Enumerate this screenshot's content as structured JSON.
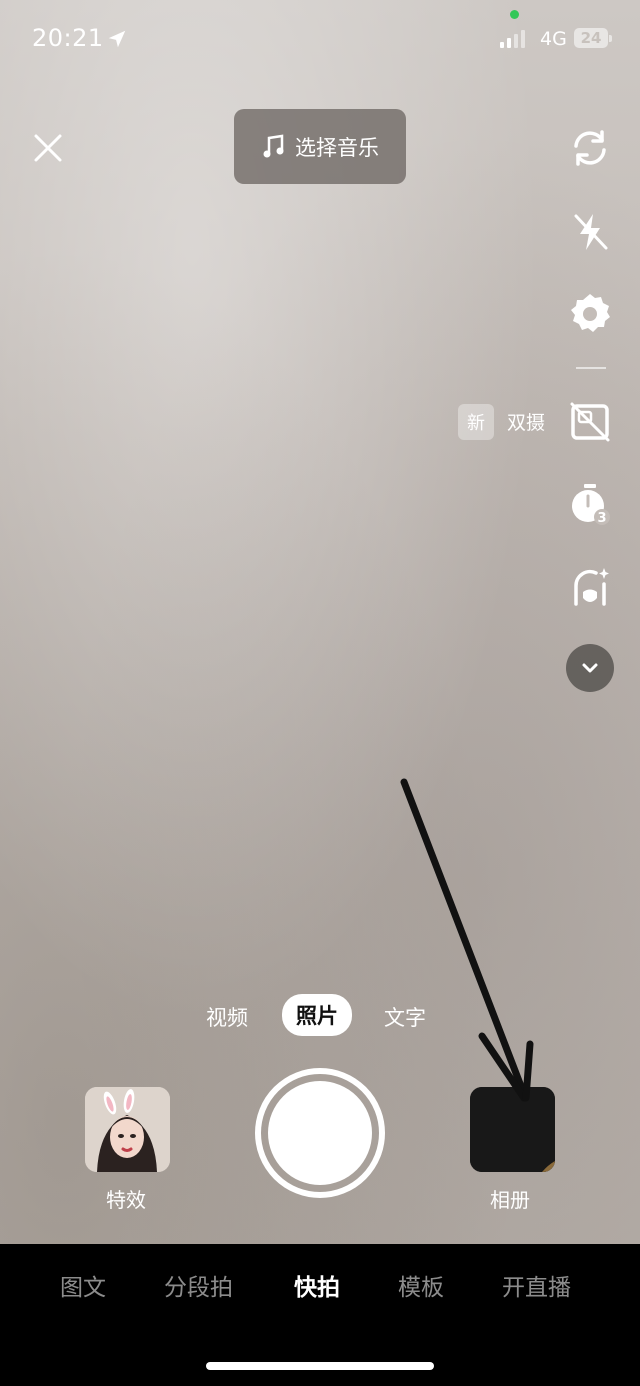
{
  "status_bar": {
    "time": "20:21",
    "network": "4G",
    "battery": "24"
  },
  "top": {
    "music_label": "选择音乐"
  },
  "side": {
    "new_badge": "新",
    "dual_camera_label": "双摄",
    "timer_value": "3"
  },
  "modes": [
    {
      "label": "视频",
      "active": false
    },
    {
      "label": "照片",
      "active": true
    },
    {
      "label": "文字",
      "active": false
    }
  ],
  "bottom_controls": {
    "effects_label": "特效",
    "album_label": "相册"
  },
  "tabs": [
    {
      "label": "图文",
      "active": false
    },
    {
      "label": "分段拍",
      "active": false
    },
    {
      "label": "快拍",
      "active": true
    },
    {
      "label": "模板",
      "active": false
    },
    {
      "label": "开直播",
      "active": false
    }
  ],
  "icons": [
    "close-icon",
    "music-note-icon",
    "flip-camera-icon",
    "flash-off-icon",
    "settings-icon",
    "dual-camera-icon",
    "timer-icon",
    "beauty-icon",
    "chevron-down-icon"
  ],
  "colors": {
    "accent": "#ffffff",
    "tab_bar": "#000000"
  }
}
